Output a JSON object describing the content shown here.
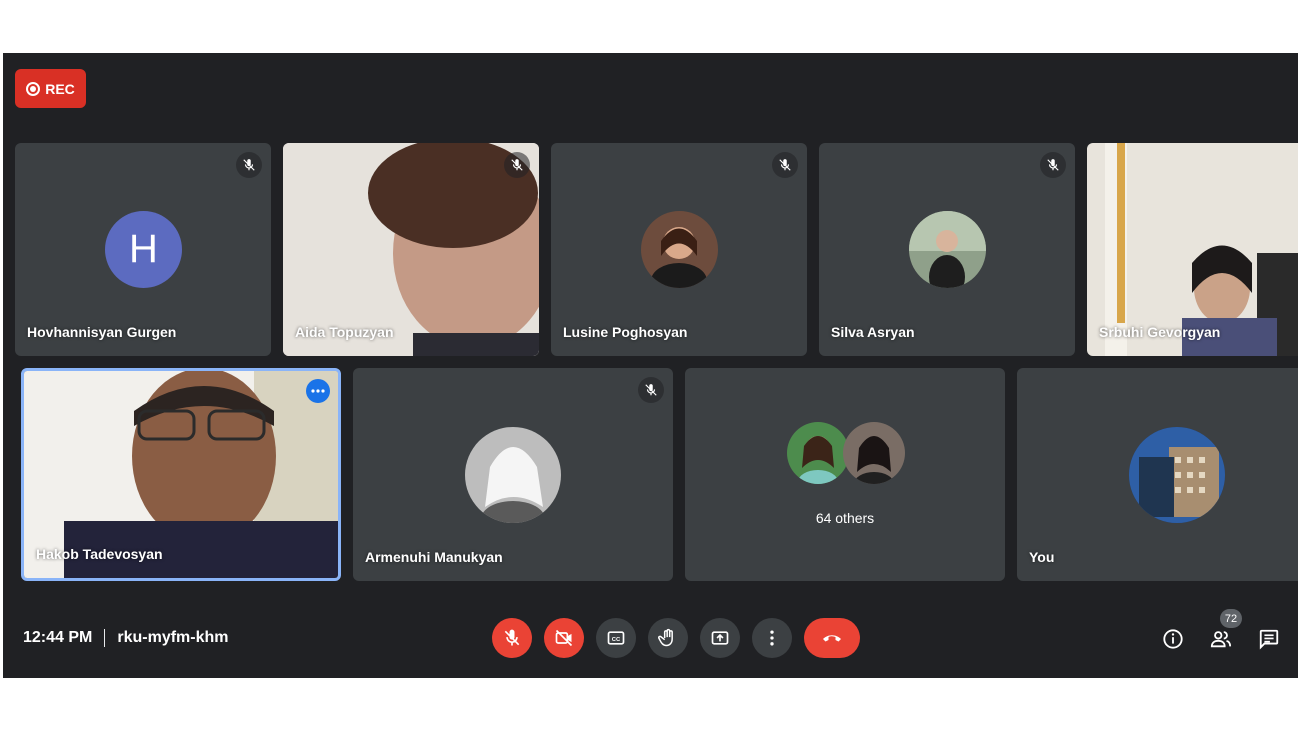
{
  "recording": {
    "label": "REC"
  },
  "participants_row1": [
    {
      "name": "Hovhannisyan Gurgen",
      "avatar_letter": "H",
      "muted": true
    },
    {
      "name": "Aida Topuzyan",
      "muted": true
    },
    {
      "name": "Lusine Poghosyan",
      "muted": true
    },
    {
      "name": "Silva Asryan",
      "muted": true
    },
    {
      "name": "Srbuhi Gevorgyan",
      "muted": false
    }
  ],
  "participants_row2": [
    {
      "name": "Hakob Tadevosyan",
      "muted": false
    },
    {
      "name": "Armenuhi Manukyan",
      "muted": true
    },
    {
      "name": "64 others"
    },
    {
      "name": "You"
    }
  ],
  "footer": {
    "time": "12:44 PM",
    "meeting_code": "rku-myfm-khm",
    "participant_count": "72"
  },
  "controls": [
    {
      "icon": "mic-off-icon"
    },
    {
      "icon": "camera-off-icon"
    },
    {
      "icon": "captions-icon"
    },
    {
      "icon": "raise-hand-icon"
    },
    {
      "icon": "present-screen-icon"
    },
    {
      "icon": "more-options-icon"
    },
    {
      "icon": "end-call-icon"
    }
  ],
  "right_controls": [
    {
      "icon": "info-icon"
    },
    {
      "icon": "people-icon"
    },
    {
      "icon": "chat-icon"
    }
  ],
  "colors": {
    "background": "#202124",
    "tile": "#3c4043",
    "red": "#ea4335",
    "accent": "#8ab4f8"
  }
}
